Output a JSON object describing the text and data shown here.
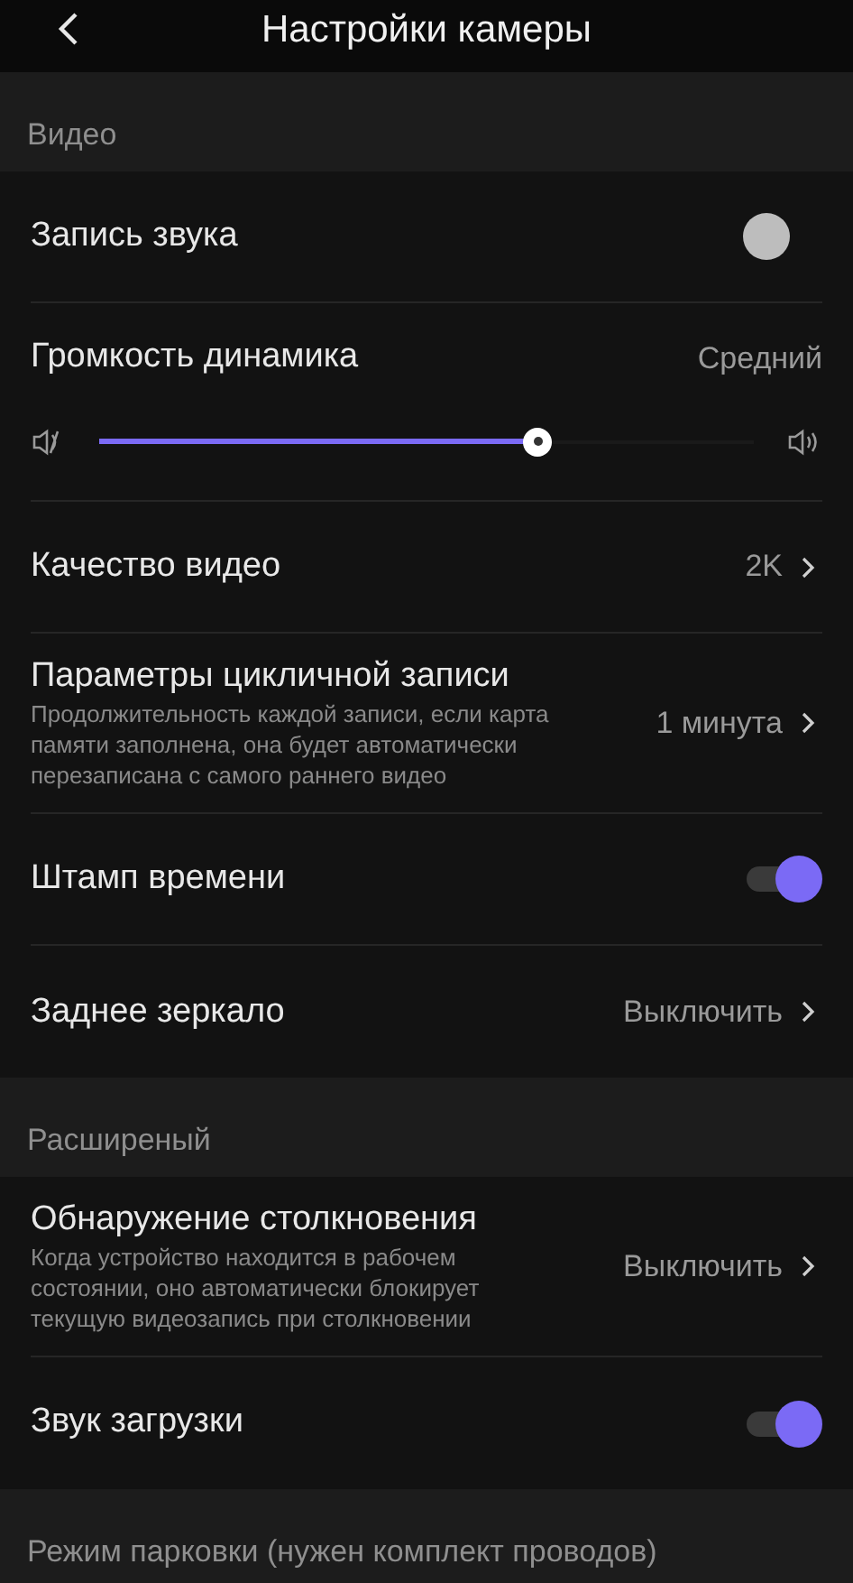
{
  "header": {
    "title": "Настройки камеры"
  },
  "sections": [
    {
      "title": "Видео",
      "items": [
        {
          "kind": "toggle",
          "label": "Запись звука",
          "on": false
        },
        {
          "kind": "slider",
          "label": "Громкость динамика",
          "value": "Средний",
          "level": 0.67
        },
        {
          "kind": "value",
          "label": "Качество видео",
          "value": "2K"
        },
        {
          "kind": "value",
          "label": "Параметры цикличной записи",
          "description": "Продолжительность каждой записи, если карта памяти заполнена, она будет автоматически перезаписана с самого раннего видео",
          "value": "1 минута"
        },
        {
          "kind": "toggle",
          "label": "Штамп времени",
          "on": true
        },
        {
          "kind": "value",
          "label": "Заднее зеркало",
          "value": "Выключить"
        }
      ]
    },
    {
      "title": "Расширеный",
      "items": [
        {
          "kind": "value",
          "label": "Обнаружение столкновения",
          "description": "Когда устройство находится в рабочем состоянии, оно автоматически блокирует текущую видеозапись при столкновении",
          "value": "Выключить"
        },
        {
          "kind": "toggle",
          "label": "Звук загрузки",
          "on": true
        }
      ]
    },
    {
      "title": "Режим парковки (нужен комплект проводов)"
    }
  ]
}
